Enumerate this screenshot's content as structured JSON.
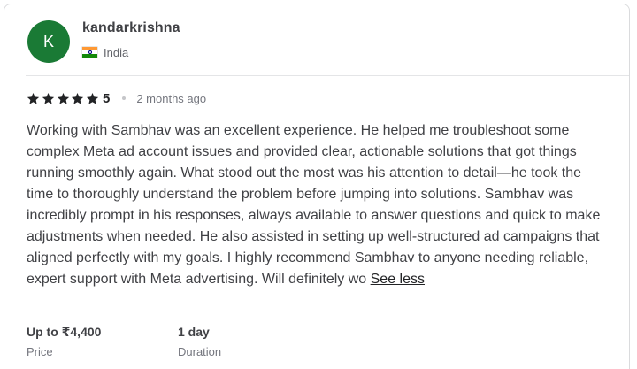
{
  "review": {
    "avatar_letter": "K",
    "avatar_color": "#1a7a35",
    "username": "kandarkrishna",
    "country": "India",
    "country_flag": "india-flag-icon",
    "rating": {
      "stars": 5,
      "value": "5",
      "star_color": "#222325"
    },
    "time_ago": "2 months ago",
    "text": "Working with Sambhav was an excellent experience. He helped me troubleshoot some complex Meta ad account issues and provided clear, actionable solutions that got things running smoothly again. What stood out the most was his attention to detail—he took the time to thoroughly understand the problem before jumping into solutions. Sambhav was incredibly prompt in his responses, always available to answer questions and quick to make adjustments when needed. He also assisted in setting up well-structured ad campaigns that aligned perfectly with my goals. I highly recommend Sambhav to anyone needing reliable, expert support with Meta advertising. Will definitely wo",
    "see_less_label": "See less",
    "price": {
      "value": "Up to ₹4,400",
      "label": "Price"
    },
    "duration": {
      "value": "1 day",
      "label": "Duration"
    }
  }
}
